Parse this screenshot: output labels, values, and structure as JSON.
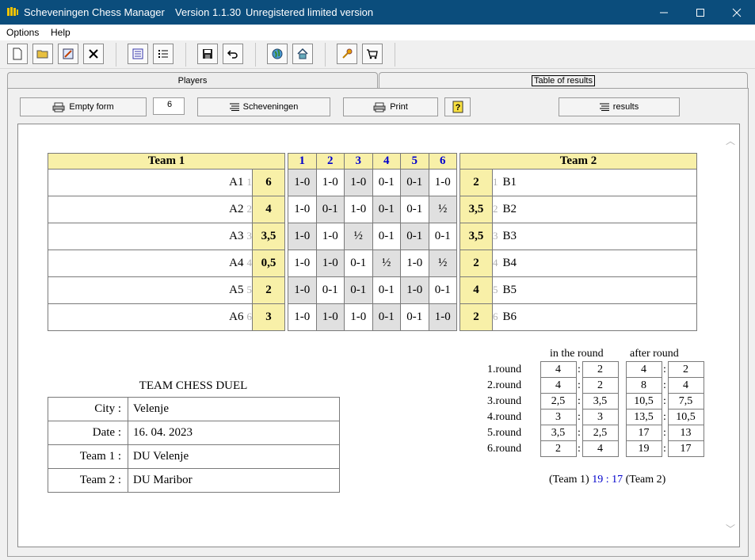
{
  "window": {
    "app_title": "Scheveningen Chess Manager",
    "version": "Version 1.1.30",
    "license": "Unregistered limited version"
  },
  "menu": [
    "Options",
    "Help"
  ],
  "toolbar_icons": [
    "new-file-icon",
    "open-folder-icon",
    "edit-icon",
    "delete-icon",
    "list-icon",
    "numbered-list-icon",
    "save-icon",
    "undo-icon",
    "web-icon",
    "home-icon",
    "key-icon",
    "cart-icon"
  ],
  "tabs": {
    "players": "Players",
    "results": "Table of results"
  },
  "controls": {
    "empty_form": "Empty form",
    "number": "6",
    "scheveningen": "Scheveningen",
    "print": "Print",
    "results": "results"
  },
  "table": {
    "team1_header": "Team 1",
    "team2_header": "Team 2",
    "rounds": [
      "1",
      "2",
      "3",
      "4",
      "5",
      "6"
    ],
    "rows": [
      {
        "a": "A1",
        "ai": "1",
        "as": "6",
        "res": [
          "1-0",
          "1-0",
          "1-0",
          "0-1",
          "0-1",
          "1-0"
        ],
        "bs": "2",
        "bi": "1",
        "b": "B1"
      },
      {
        "a": "A2",
        "ai": "2",
        "as": "4",
        "res": [
          "1-0",
          "0-1",
          "1-0",
          "0-1",
          "0-1",
          "½"
        ],
        "bs": "3,5",
        "bi": "2",
        "b": "B2"
      },
      {
        "a": "A3",
        "ai": "3",
        "as": "3,5",
        "res": [
          "1-0",
          "1-0",
          "½",
          "0-1",
          "0-1",
          "0-1"
        ],
        "bs": "3,5",
        "bi": "3",
        "b": "B3"
      },
      {
        "a": "A4",
        "ai": "4",
        "as": "0,5",
        "res": [
          "1-0",
          "1-0",
          "0-1",
          "½",
          "1-0",
          "½"
        ],
        "bs": "2",
        "bi": "4",
        "b": "B4"
      },
      {
        "a": "A5",
        "ai": "5",
        "as": "2",
        "res": [
          "1-0",
          "0-1",
          "0-1",
          "0-1",
          "1-0",
          "0-1"
        ],
        "bs": "4",
        "bi": "5",
        "b": "B5"
      },
      {
        "a": "A6",
        "ai": "6",
        "as": "3",
        "res": [
          "1-0",
          "1-0",
          "1-0",
          "0-1",
          "0-1",
          "1-0"
        ],
        "bs": "2",
        "bi": "6",
        "b": "B6"
      }
    ]
  },
  "duel": {
    "title": "TEAM CHESS DUEL",
    "rows": [
      {
        "k": "City :",
        "v": "Velenje"
      },
      {
        "k": "Date :",
        "v": "16. 04. 2023"
      },
      {
        "k": "Team 1 :",
        "v": "DU Velenje"
      },
      {
        "k": "Team 2 :",
        "v": "DU Maribor"
      }
    ]
  },
  "rounds_summary": {
    "in_the_round": "in the round",
    "after_round": "after round",
    "colon": ":",
    "rows": [
      {
        "label": "1.round",
        "i1": "4",
        "i2": "2",
        "a1": "4",
        "a2": "2"
      },
      {
        "label": "2.round",
        "i1": "4",
        "i2": "2",
        "a1": "8",
        "a2": "4"
      },
      {
        "label": "3.round",
        "i1": "2,5",
        "i2": "3,5",
        "a1": "10,5",
        "a2": "7,5"
      },
      {
        "label": "4.round",
        "i1": "3",
        "i2": "3",
        "a1": "13,5",
        "a2": "10,5"
      },
      {
        "label": "5.round",
        "i1": "3,5",
        "i2": "2,5",
        "a1": "17",
        "a2": "13"
      },
      {
        "label": "6.round",
        "i1": "2",
        "i2": "4",
        "a1": "19",
        "a2": "17"
      }
    ],
    "total_left": "(Team 1)",
    "total_t1": "19",
    "total_sep": ":",
    "total_t2": "17",
    "total_right": "(Team 2)"
  }
}
